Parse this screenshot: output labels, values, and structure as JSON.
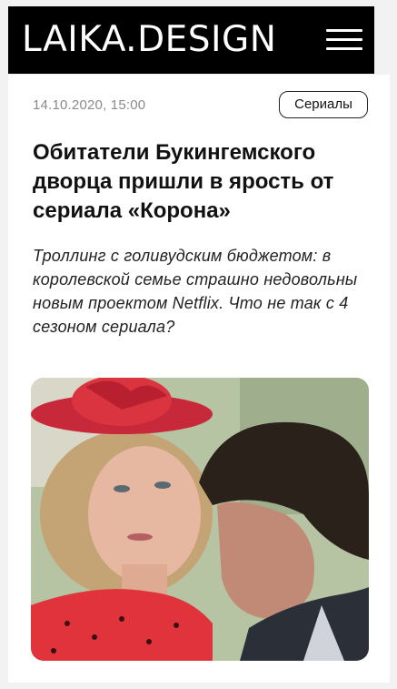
{
  "header": {
    "logo": "LAIKA.DESIGN",
    "menu_icon": "hamburger-menu-icon"
  },
  "article": {
    "date": "14.10.2020, 15:00",
    "tag": "Сериалы",
    "title": "Обитатели Букингемского дворца пришли в ярость от сериала «Корона»",
    "subtitle": "Троллинг с голивудским бюджетом: в королевской семье страшно недовольны новым проектом Netflix. Что не так с 4 сезоном сериала?"
  },
  "colors": {
    "header_bg": "#000000",
    "page_bg": "#f2f2f2",
    "card_bg": "#ffffff",
    "hat_red": "#d9343f",
    "dress_red": "#e0333b"
  }
}
